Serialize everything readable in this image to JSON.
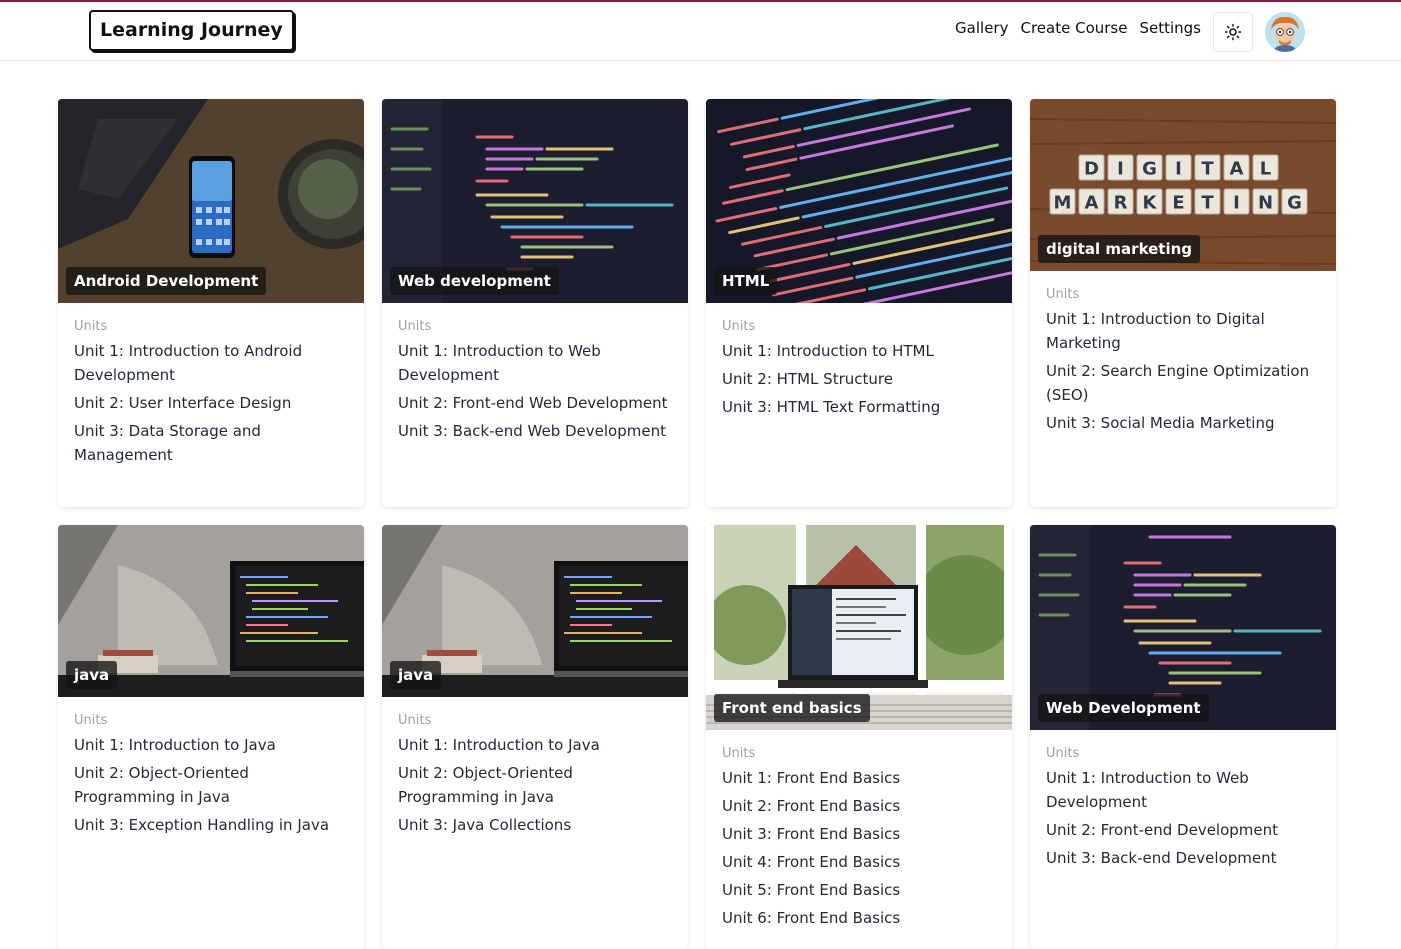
{
  "header": {
    "logo": "Learning Journey",
    "nav": [
      "Gallery",
      "Create Course",
      "Settings"
    ],
    "theme_icon": "sun-icon",
    "avatar_icon": "user-avatar"
  },
  "colors": {
    "accent_line": "#8b1d3f"
  },
  "units_label": "Units",
  "courses": [
    {
      "title": "Android Development",
      "units": [
        "Unit 1: Introduction to Android Development",
        "Unit 2: User Interface Design",
        "Unit 3: Data Storage and Management"
      ]
    },
    {
      "title": "Web development",
      "units": [
        "Unit 1: Introduction to Web Development",
        "Unit 2: Front-end Web Development",
        "Unit 3: Back-end Web Development"
      ]
    },
    {
      "title": "HTML",
      "units": [
        "Unit 1: Introduction to HTML",
        "Unit 2: HTML Structure",
        "Unit 3: HTML Text Formatting"
      ]
    },
    {
      "title": "digital marketing",
      "units": [
        "Unit 1: Introduction to Digital Marketing",
        "Unit 2: Search Engine Optimization (SEO)",
        "Unit 3: Social Media Marketing"
      ]
    },
    {
      "title": "java",
      "units": [
        "Unit 1: Introduction to Java",
        "Unit 2: Object-Oriented Programming in Java",
        "Unit 3: Exception Handling in Java"
      ]
    },
    {
      "title": "java",
      "units": [
        "Unit 1: Introduction to Java",
        "Unit 2: Object-Oriented Programming in Java",
        "Unit 3: Java Collections"
      ]
    },
    {
      "title": "Front end basics",
      "units": [
        "Unit 1: Front End Basics",
        "Unit 2: Front End Basics",
        "Unit 3: Front End Basics",
        "Unit 4: Front End Basics",
        "Unit 5: Front End Basics",
        "Unit 6: Front End Basics"
      ]
    },
    {
      "title": "Web Development",
      "units": [
        "Unit 1: Introduction to Web Development",
        "Unit 2: Front-end Development",
        "Unit 3: Back-end Development"
      ]
    }
  ],
  "image_letters": {
    "digital": [
      "D",
      "I",
      "G",
      "I",
      "T",
      "A",
      "L"
    ],
    "marketing": [
      "M",
      "A",
      "R",
      "K",
      "E",
      "T",
      "I",
      "N",
      "G"
    ]
  }
}
